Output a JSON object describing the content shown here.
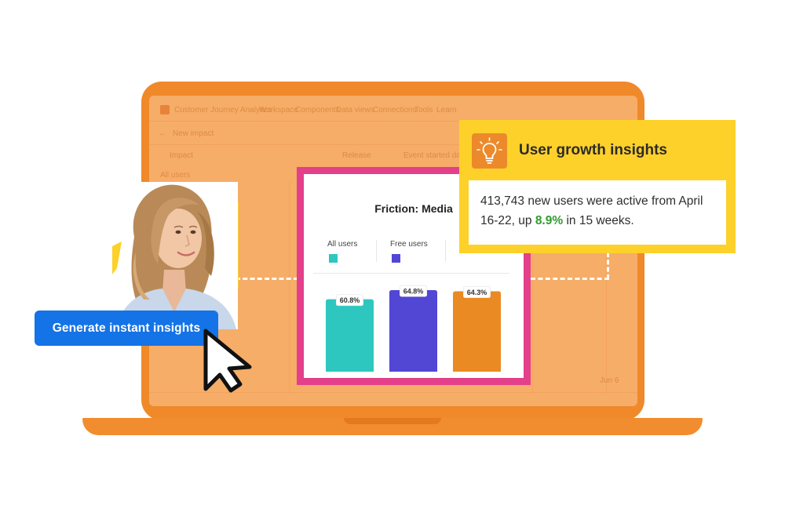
{
  "background_app": {
    "title": "Customer Journey Analytics",
    "nav": [
      "Workspace",
      "Components",
      "Data views",
      "Connections",
      "Tools",
      "Learn"
    ],
    "subtitle": "New impact",
    "filter_left": "Impact",
    "filter_mid": "Release",
    "filter_right": "Event started date",
    "left_label": "All users",
    "axis_label": "Jun 6"
  },
  "chart": {
    "title": "Friction: Media",
    "colors": {
      "frame": "#e43f8a"
    }
  },
  "chart_data": {
    "type": "bar",
    "title": "Friction: Media",
    "categories": [
      "All users",
      "Free users",
      ""
    ],
    "values": [
      60.8,
      64.8,
      64.3
    ],
    "data_labels": [
      "60.8%",
      "64.8%",
      "64.3%"
    ],
    "colors": [
      "#2ec7c0",
      "#5147d4",
      "#ea8a22"
    ],
    "legend": [
      {
        "name": "All users",
        "color": "#2ec7c0"
      },
      {
        "name": "Free users",
        "color": "#5147d4"
      }
    ],
    "grid": false
  },
  "insights": {
    "title": "User growth insights",
    "icon": "lightbulb-icon",
    "text_before": "413,743 new users were active from April 16-22, up ",
    "highlight": "8.9%",
    "text_after": " in 15 weeks.",
    "colors": {
      "card": "#fdd12a",
      "icon_bg": "#ec8a2b",
      "highlight": "#2f9b2f"
    }
  },
  "cta": {
    "label": "Generate instant insights",
    "color": "#1473e6"
  }
}
